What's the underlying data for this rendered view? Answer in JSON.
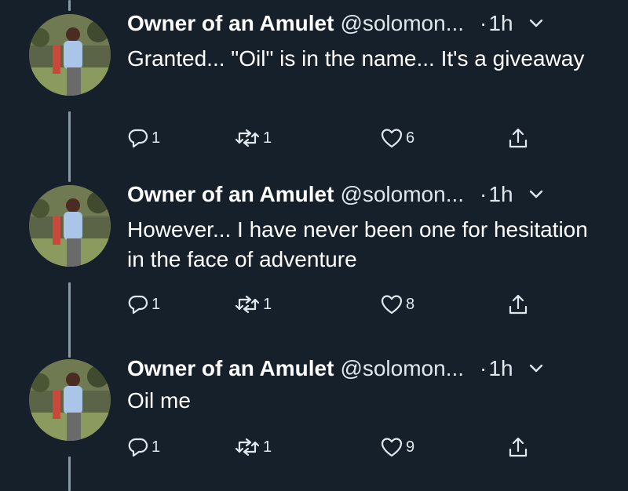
{
  "tweets": [
    {
      "author_name": "Owner of an Amulet",
      "handle": "@solomon...",
      "separator": "·",
      "time": "1h",
      "text": "Granted... \"Oil\" is in the name... It's a giveaway",
      "replies": "1",
      "retweets": "1",
      "likes": "6"
    },
    {
      "author_name": "Owner of an Amulet",
      "handle": "@solomon...",
      "separator": "·",
      "time": "1h",
      "text": "However... I have never been one for hesitation in the face of adventure",
      "replies": "1",
      "retweets": "1",
      "likes": "8"
    },
    {
      "author_name": "Owner of an Amulet",
      "handle": "@solomon...",
      "separator": "·",
      "time": "1h",
      "text": "Oil me",
      "replies": "1",
      "retweets": "1",
      "likes": "9"
    }
  ],
  "icons": {
    "reply": "reply-icon",
    "retweet": "retweet-icon",
    "like": "heart-icon",
    "share": "share-icon",
    "more": "chevron-down-icon"
  },
  "colors": {
    "background": "#15202b",
    "text": "#ffffff",
    "secondary_text": "#e1e8ed",
    "thread_line": "#8899a6"
  }
}
